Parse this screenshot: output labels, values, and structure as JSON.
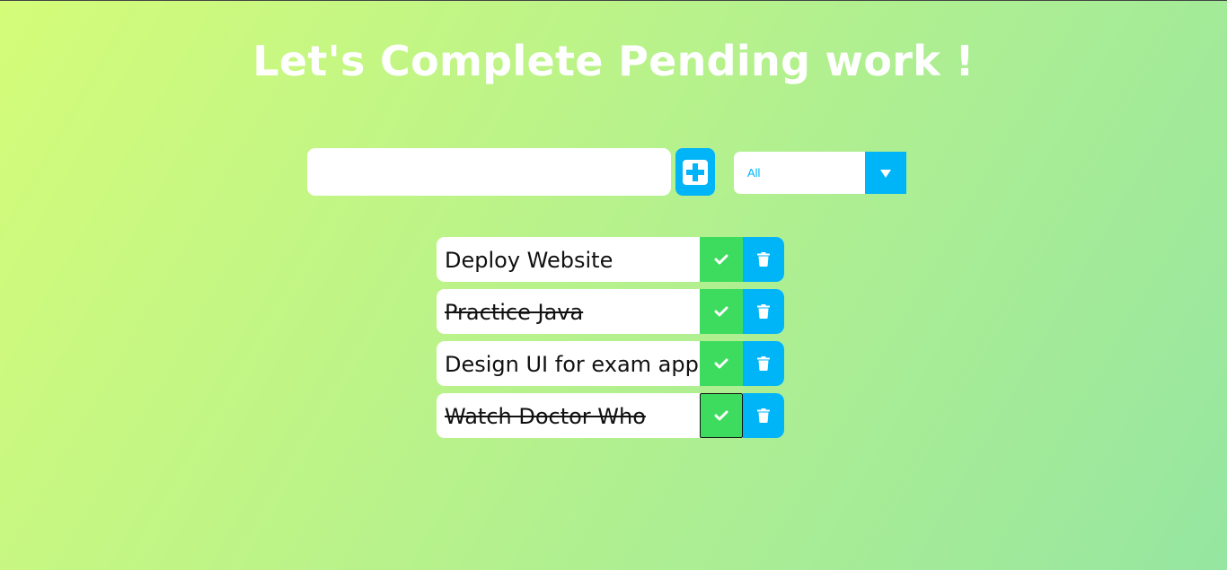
{
  "header": {
    "title": "Let's Complete Pending work !"
  },
  "form": {
    "input_value": "",
    "input_placeholder": "",
    "add_icon": "plus-square-icon",
    "filter": {
      "selected": "All",
      "arrow_icon": "caret-down-icon"
    }
  },
  "todos": [
    {
      "text": "Deploy Website",
      "completed": false
    },
    {
      "text": "Practice Java",
      "completed": true
    },
    {
      "text": "Design UI for exam app",
      "completed": false
    },
    {
      "text": "Watch Doctor Who",
      "completed": true
    }
  ],
  "icons": {
    "check": "check-icon",
    "trash": "trash-icon"
  },
  "colors": {
    "accent": "#00b4f8",
    "check": "#3ddc5e",
    "gradient_start": "#d4fc79",
    "gradient_end": "#96e6a1",
    "title": "#ffffff"
  }
}
